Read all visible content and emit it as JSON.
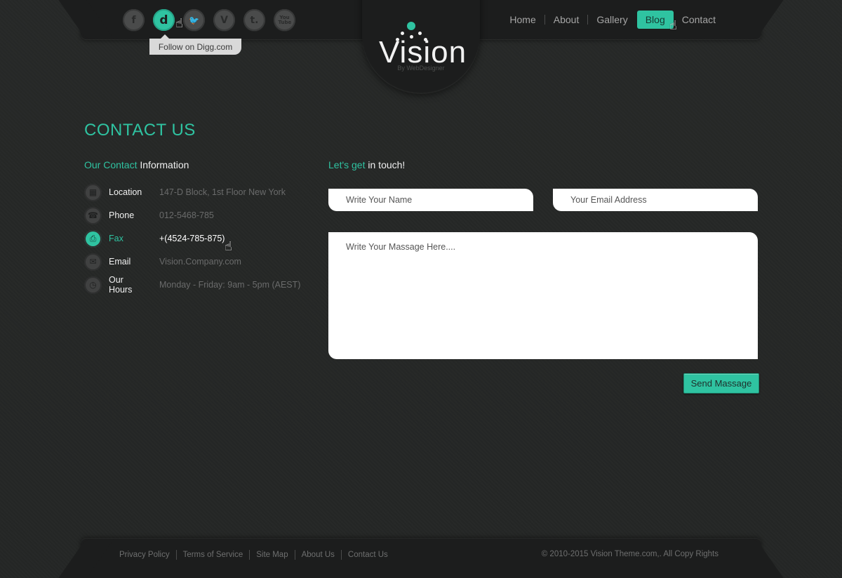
{
  "brand": {
    "logo_word": "Vision",
    "logo_sub": "By WebDesigner",
    "accent_color": "#2fc3a1"
  },
  "social": {
    "items": [
      {
        "name": "facebook",
        "glyph": "f",
        "active": false
      },
      {
        "name": "digg",
        "glyph": "d",
        "active": true
      },
      {
        "name": "twitter",
        "glyph": "🐦",
        "active": false
      },
      {
        "name": "vimeo",
        "glyph": "V",
        "active": false
      },
      {
        "name": "tumblr",
        "glyph": "t.",
        "active": false
      },
      {
        "name": "youtube",
        "glyph": "You Tube",
        "active": false
      }
    ],
    "tooltip": "Follow on Digg.com"
  },
  "nav": {
    "items": [
      {
        "label": "Home",
        "active": false
      },
      {
        "label": "About",
        "active": false
      },
      {
        "label": "Gallery",
        "active": false
      },
      {
        "label": "Blog",
        "active": true
      },
      {
        "label": "Contact",
        "active": false
      }
    ]
  },
  "page": {
    "title": "CONTACT US"
  },
  "contact_info": {
    "heading_accent": "Our Contact",
    "heading_rest": " Information",
    "rows": [
      {
        "icon": "building-icon",
        "label": "Location",
        "value": "147-D Block, 1st Floor New York",
        "active": false
      },
      {
        "icon": "phone-icon",
        "label": "Phone",
        "value": "012-5468-785",
        "active": false
      },
      {
        "icon": "fax-icon",
        "label": "Fax",
        "value": "+(4524-785-875)",
        "active": true
      },
      {
        "icon": "envelope-icon",
        "label": "Email",
        "value": "Vision.Company.com",
        "active": false
      },
      {
        "icon": "clock-icon",
        "label": "Our Hours",
        "value": "Monday - Friday: 9am - 5pm (AEST)",
        "active": false
      }
    ]
  },
  "form": {
    "heading_accent": "Let's get",
    "heading_rest": " in touch!",
    "name_placeholder": "Write Your Name",
    "email_placeholder": "Your Email Address",
    "message_placeholder": "Write Your Massage Here....",
    "send_label": "Send Massage"
  },
  "footer": {
    "links": [
      "Privacy Policy",
      "Terms of Service",
      "Site Map",
      "About Us",
      "Contact Us"
    ],
    "copyright": "© 2010-2015 Vision Theme.com,. All Copy Rights"
  }
}
